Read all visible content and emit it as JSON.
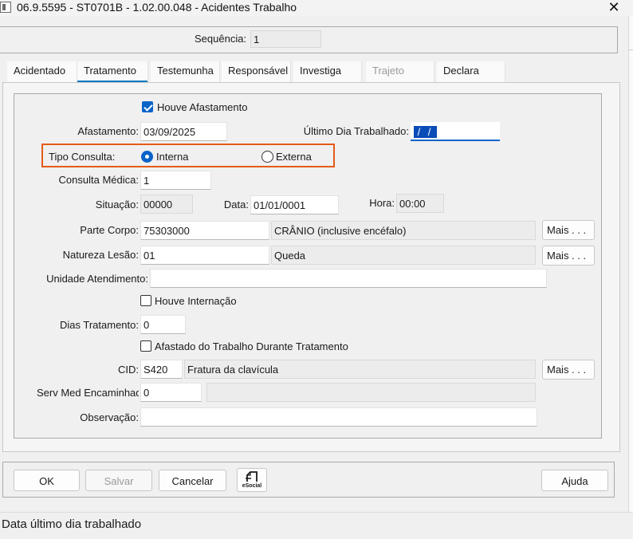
{
  "window": {
    "title": "06.9.5595 - ST0701B - 1.02.00.048 - Acidentes Trabalho",
    "close_glyph": "✕"
  },
  "sequence": {
    "label": "Sequência:",
    "value": "1"
  },
  "tabs": [
    {
      "label": "Acidentado",
      "state": "normal"
    },
    {
      "label": "Tratamento",
      "state": "active"
    },
    {
      "label": "Testemunha",
      "state": "normal"
    },
    {
      "label": "Responsável",
      "state": "normal"
    },
    {
      "label": "Investiga",
      "state": "normal"
    },
    {
      "label": "Trajeto",
      "state": "disabled"
    },
    {
      "label": "Declara",
      "state": "normal"
    }
  ],
  "form": {
    "houve_afastamento": {
      "label": "Houve Afastamento",
      "checked": true
    },
    "afastamento": {
      "label": "Afastamento:",
      "value": "03/09/2025"
    },
    "ultimo_dia": {
      "label": "Último Dia Trabalhado:",
      "value": "/ /"
    },
    "tipo_consulta": {
      "label": "Tipo Consulta:",
      "options": [
        "Interna",
        "Externa"
      ],
      "selected": "Interna"
    },
    "consulta_medica": {
      "label": "Consulta Médica:",
      "value": "1"
    },
    "situacao": {
      "label": "Situação:",
      "value": "00000"
    },
    "data": {
      "label": "Data:",
      "value": "01/01/0001"
    },
    "hora": {
      "label": "Hora:",
      "value": "00:00"
    },
    "parte_corpo": {
      "label": "Parte Corpo:",
      "code": "75303000",
      "description": "CRÂNIO (inclusive encéfalo)"
    },
    "natureza_lesao": {
      "label": "Natureza Lesão:",
      "code": "01",
      "description": "Queda"
    },
    "unidade_atendimento": {
      "label": "Unidade Atendimento:",
      "value": ""
    },
    "houve_internacao": {
      "label": "Houve Internação",
      "checked": false
    },
    "dias_tratamento": {
      "label": "Dias Tratamento:",
      "value": "0"
    },
    "afastado_durante": {
      "label": "Afastado do Trabalho Durante Tratamento",
      "checked": false
    },
    "cid": {
      "label": "CID:",
      "code": "S420",
      "description": "Fratura da clavícula"
    },
    "serv_med": {
      "label": "Serv Med Encaminhado:",
      "value": "0",
      "description": ""
    },
    "observacao": {
      "label": "Observação:",
      "value": ""
    },
    "more_label": "Mais . . ."
  },
  "buttons": {
    "ok": "OK",
    "salvar": "Salvar",
    "cancelar": "Cancelar",
    "esocial": "eSocial",
    "ajuda": "Ajuda"
  },
  "status": {
    "text": "Data último dia trabalhado"
  },
  "colors": {
    "accent": "#0a64c8",
    "highlight": "#e55a16"
  }
}
